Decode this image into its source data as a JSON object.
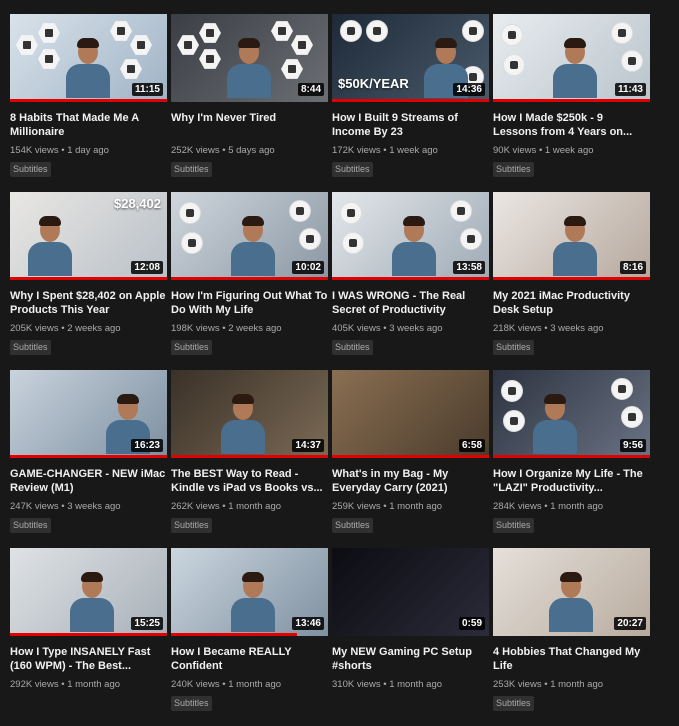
{
  "colors": {
    "background": "#181818",
    "progress": "#e00000"
  },
  "videos": [
    {
      "title": "8 Habits That Made Me A Millionaire",
      "views": "154K views",
      "sep": "•",
      "age": "1 day ago",
      "duration": "11:15",
      "badge": "Subtitles",
      "watched": 1.0
    },
    {
      "title": "Why I'm Never Tired",
      "views": "252K views",
      "sep": "•",
      "age": "5 days ago",
      "duration": "8:44",
      "badge": "Subtitles",
      "watched": 0.0
    },
    {
      "title": "How I Built 9 Streams of Income By 23",
      "views": "172K views",
      "sep": "•",
      "age": "1 week ago",
      "duration": "14:36",
      "badge": "Subtitles",
      "watched": 1.0,
      "overlay": "$50K/YEAR"
    },
    {
      "title": "How I Made $250k - 9 Lessons from 4 Years on...",
      "views": "90K views",
      "sep": "•",
      "age": "1 week ago",
      "duration": "11:43",
      "badge": "Subtitles",
      "watched": 1.0
    },
    {
      "title": "Why I Spent $28,402 on Apple Products This Year",
      "views": "205K views",
      "sep": "•",
      "age": "2 weeks ago",
      "duration": "12:08",
      "badge": "Subtitles",
      "watched": 1.0,
      "overlay": "$28,402"
    },
    {
      "title": "How I'm Figuring Out What To Do With My Life",
      "views": "198K views",
      "sep": "•",
      "age": "2 weeks ago",
      "duration": "10:02",
      "badge": "Subtitles",
      "watched": 1.0
    },
    {
      "title": "I WAS WRONG - The Real Secret of Productivity",
      "views": "405K views",
      "sep": "•",
      "age": "3 weeks ago",
      "duration": "13:58",
      "badge": "Subtitles",
      "watched": 1.0
    },
    {
      "title": "My 2021 iMac Productivity Desk Setup",
      "views": "218K views",
      "sep": "•",
      "age": "3 weeks ago",
      "duration": "8:16",
      "badge": "Subtitles",
      "watched": 1.0
    },
    {
      "title": "GAME-CHANGER - NEW iMac Review (M1)",
      "views": "247K views",
      "sep": "•",
      "age": "3 weeks ago",
      "duration": "16:23",
      "badge": "Subtitles",
      "watched": 1.0
    },
    {
      "title": "The BEST Way to Read - Kindle vs iPad vs Books vs...",
      "views": "262K views",
      "sep": "•",
      "age": "1 month ago",
      "duration": "14:37",
      "badge": "Subtitles",
      "watched": 1.0
    },
    {
      "title": "What's in my Bag - My Everyday Carry (2021)",
      "views": "259K views",
      "sep": "•",
      "age": "1 month ago",
      "duration": "6:58",
      "badge": "Subtitles",
      "watched": 1.0
    },
    {
      "title": "How I Organize My Life - The \"LAZI\" Productivity...",
      "views": "284K views",
      "sep": "•",
      "age": "1 month ago",
      "duration": "9:56",
      "badge": "Subtitles",
      "watched": 1.0
    },
    {
      "title": "How I Type INSANELY Fast (160 WPM) - The Best...",
      "views": "292K views",
      "sep": "•",
      "age": "1 month ago",
      "duration": "15:25",
      "badge": "",
      "watched": 1.0
    },
    {
      "title": "How I Became REALLY Confident",
      "views": "240K views",
      "sep": "•",
      "age": "1 month ago",
      "duration": "13:46",
      "badge": "Subtitles",
      "watched": 0.8
    },
    {
      "title": "My NEW Gaming PC Setup #shorts",
      "views": "310K views",
      "sep": "•",
      "age": "1 month ago",
      "duration": "0:59",
      "badge": "",
      "watched": 0.0
    },
    {
      "title": "4 Hobbies That Changed My Life",
      "views": "253K views",
      "sep": "•",
      "age": "1 month ago",
      "duration": "20:27",
      "badge": "Subtitles",
      "watched": 0.0
    }
  ]
}
